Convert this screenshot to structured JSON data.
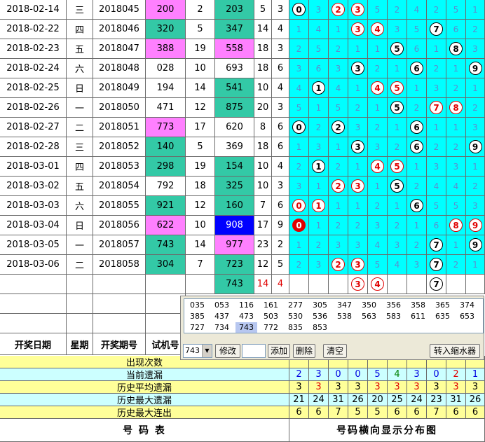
{
  "rows": [
    {
      "date": "2018-02-14",
      "weekday": "三",
      "issue": "2018045",
      "test": "200",
      "span": "2",
      "draw": "203",
      "sum": "5",
      "kind": "3",
      "dist": [
        [
          "c",
          "0"
        ],
        "3",
        [
          "r",
          "2"
        ],
        [
          "r",
          "3"
        ],
        "5",
        "2",
        "4",
        "2",
        "5",
        "1"
      ]
    },
    {
      "date": "2018-02-22",
      "weekday": "四",
      "issue": "2018046",
      "test": "320",
      "span": "5",
      "draw": "347",
      "sum": "14",
      "kind": "4",
      "dist": [
        "1",
        "4",
        "1",
        [
          "r",
          "3"
        ],
        [
          "r",
          "4"
        ],
        "3",
        "5",
        [
          "c",
          "7"
        ],
        "6",
        "2"
      ]
    },
    {
      "date": "2018-02-23",
      "weekday": "五",
      "issue": "2018047",
      "test": "388",
      "span": "19",
      "draw": "558",
      "sum": "18",
      "kind": "3",
      "dist": [
        "2",
        "5",
        "2",
        "1",
        "1",
        [
          "c",
          "5"
        ],
        "6",
        "1",
        [
          "c",
          "8"
        ],
        "3"
      ]
    },
    {
      "date": "2018-02-24",
      "weekday": "六",
      "issue": "2018048",
      "test": "028",
      "span": "10",
      "draw": "693",
      "sum": "18",
      "kind": "6",
      "dist": [
        "3",
        "6",
        "3",
        [
          "c",
          "3"
        ],
        "2",
        "1",
        [
          "c",
          "6"
        ],
        "2",
        "1",
        [
          "c",
          "9"
        ]
      ]
    },
    {
      "date": "2018-02-25",
      "weekday": "日",
      "issue": "2018049",
      "test": "194",
      "span": "14",
      "draw": "541",
      "sum": "10",
      "kind": "4",
      "dist": [
        "4",
        [
          "c",
          "1"
        ],
        "4",
        "1",
        [
          "r",
          "4"
        ],
        [
          "r",
          "5"
        ],
        "1",
        "3",
        "2",
        "1"
      ]
    },
    {
      "date": "2018-02-26",
      "weekday": "一",
      "issue": "2018050",
      "test": "471",
      "span": "12",
      "draw": "875",
      "sum": "20",
      "kind": "3",
      "dist": [
        "5",
        "1",
        "5",
        "2",
        "1",
        [
          "c",
          "5"
        ],
        "2",
        [
          "r",
          "7"
        ],
        [
          "r",
          "8"
        ],
        "2"
      ]
    },
    {
      "date": "2018-02-27",
      "weekday": "二",
      "issue": "2018051",
      "test": "773",
      "span": "17",
      "draw": "620",
      "sum": "8",
      "kind": "6",
      "dist": [
        [
          "c",
          "0"
        ],
        "2",
        [
          "c",
          "2"
        ],
        "3",
        "2",
        "1",
        [
          "c",
          "6"
        ],
        "1",
        "1",
        "3"
      ]
    },
    {
      "date": "2018-02-28",
      "weekday": "三",
      "issue": "2018052",
      "test": "140",
      "span": "5",
      "draw": "369",
      "sum": "18",
      "kind": "6",
      "dist": [
        "1",
        "3",
        "1",
        [
          "c",
          "3"
        ],
        "3",
        "2",
        [
          "c",
          "6"
        ],
        "2",
        "2",
        [
          "c",
          "9"
        ]
      ]
    },
    {
      "date": "2018-03-01",
      "weekday": "四",
      "issue": "2018053",
      "test": "298",
      "span": "19",
      "draw": "154",
      "sum": "10",
      "kind": "4",
      "dist": [
        "2",
        [
          "c",
          "1"
        ],
        "2",
        "1",
        [
          "r",
          "4"
        ],
        [
          "r",
          "5"
        ],
        "1",
        "3",
        "3",
        "1"
      ]
    },
    {
      "date": "2018-03-02",
      "weekday": "五",
      "issue": "2018054",
      "test": "792",
      "span": "18",
      "draw": "325",
      "sum": "10",
      "kind": "3",
      "dist": [
        "3",
        "1",
        [
          "r",
          "2"
        ],
        [
          "r",
          "3"
        ],
        "1",
        [
          "c",
          "5"
        ],
        "2",
        "4",
        "4",
        "2"
      ]
    },
    {
      "date": "2018-03-03",
      "weekday": "六",
      "issue": "2018055",
      "test": "921",
      "span": "12",
      "draw": "160",
      "sum": "7",
      "kind": "6",
      "dist": [
        [
          "r",
          "0"
        ],
        [
          "r",
          "1"
        ],
        "1",
        "1",
        "2",
        "1",
        [
          "c",
          "6"
        ],
        "5",
        "5",
        "3"
      ]
    },
    {
      "date": "2018-03-04",
      "weekday": "日",
      "issue": "2018056",
      "test": "622",
      "span": "10",
      "draw": "908",
      "sum": "17",
      "kind": "9",
      "dist": [
        [
          "f",
          "0"
        ],
        "1",
        "2",
        "2",
        "3",
        "2",
        "1",
        "6",
        [
          "r",
          "8"
        ],
        [
          "r",
          "9"
        ]
      ]
    },
    {
      "date": "2018-03-05",
      "weekday": "一",
      "issue": "2018057",
      "test": "743",
      "span": "14",
      "draw": "977",
      "sum": "23",
      "kind": "2",
      "dist": [
        "1",
        "2",
        "3",
        "3",
        "4",
        "3",
        "2",
        [
          "c",
          "7"
        ],
        "1",
        [
          "c",
          "9"
        ]
      ]
    },
    {
      "date": "2018-03-06",
      "weekday": "二",
      "issue": "2018058",
      "test": "304",
      "span": "7",
      "draw": "723",
      "sum": "12",
      "kind": "5",
      "dist": [
        "2",
        "3",
        [
          "r",
          "2"
        ],
        [
          "r",
          "3"
        ],
        "5",
        "4",
        "3",
        [
          "c",
          "7"
        ],
        "2",
        "1"
      ]
    }
  ],
  "row_colors": [
    {
      "test": "pk",
      "draw": "tl"
    },
    {
      "test": "tl",
      "draw": "tl"
    },
    {
      "test": "pk",
      "draw": "pk"
    },
    {
      "test": "w",
      "draw": "w"
    },
    {
      "test": "w",
      "draw": "tl"
    },
    {
      "test": "w",
      "draw": "tl"
    },
    {
      "test": "pk",
      "draw": "w"
    },
    {
      "test": "tl",
      "draw": "w"
    },
    {
      "test": "tl",
      "draw": "tl"
    },
    {
      "test": "w",
      "draw": "tl"
    },
    {
      "test": "tl",
      "draw": "tl"
    },
    {
      "test": "pk",
      "draw": "bl"
    },
    {
      "test": "tl",
      "draw": "pk"
    },
    {
      "test": "tl",
      "draw": "tl"
    }
  ],
  "forecast_row": {
    "draw": "743",
    "sum": "14",
    "kind": "4",
    "marks": {
      "3": "3",
      "4": "4",
      "7": "7"
    }
  },
  "headers": {
    "date": "开奖日期",
    "weekday": "星期",
    "issue": "开奖期号",
    "test": "试机号"
  },
  "stats": [
    {
      "label": "出现次数",
      "values": [
        "",
        "",
        "",
        "",
        "",
        "",
        "",
        "",
        "",
        ""
      ]
    },
    {
      "label": "当前遗漏",
      "values": [
        "2",
        "3",
        "0",
        "0",
        "5",
        "4",
        "3",
        "0",
        "2",
        "1"
      ],
      "colors": [
        "blu",
        "blu",
        "blu",
        "blu",
        "blu",
        "grn",
        "blu",
        "blu",
        "red",
        "blu"
      ]
    },
    {
      "label": "历史平均遗漏",
      "values": [
        "3",
        "3",
        "3",
        "3",
        "3",
        "3",
        "3",
        "3",
        "3",
        "3"
      ],
      "colors": [
        "",
        "red",
        "",
        "",
        "red",
        "red",
        "red",
        "",
        "red",
        ""
      ]
    },
    {
      "label": "历史最大遗漏",
      "values": [
        "21",
        "24",
        "31",
        "26",
        "20",
        "25",
        "24",
        "23",
        "31",
        "26"
      ]
    },
    {
      "label": "历史最大连出",
      "values": [
        "6",
        "6",
        "7",
        "5",
        "5",
        "6",
        "6",
        "7",
        "6",
        "6"
      ]
    }
  ],
  "footer": {
    "left": "号 码 表",
    "right": "号码横向显示分布图"
  },
  "panel": {
    "numbers": [
      "035",
      "053",
      "116",
      "161",
      "277",
      "305",
      "347",
      "350",
      "356",
      "358",
      "365",
      "374",
      "385",
      "437",
      "473",
      "503",
      "530",
      "536",
      "538",
      "563",
      "583",
      "611",
      "635",
      "653",
      "727",
      "734",
      "743",
      "772",
      "835",
      "853"
    ],
    "selected": "743",
    "combo_value": "743",
    "buttons": {
      "modify": "修改",
      "add": "添加",
      "delete": "删除",
      "clear": "清空",
      "transfer": "转入缩水器"
    }
  },
  "colors": {
    "pink": "#ff80ff",
    "teal": "#33c9a6",
    "cyan": "#00ffff",
    "blue": "#0000ff",
    "yellow": "#ffff99",
    "lightcyan": "#ccffff",
    "red": "#e00000"
  }
}
